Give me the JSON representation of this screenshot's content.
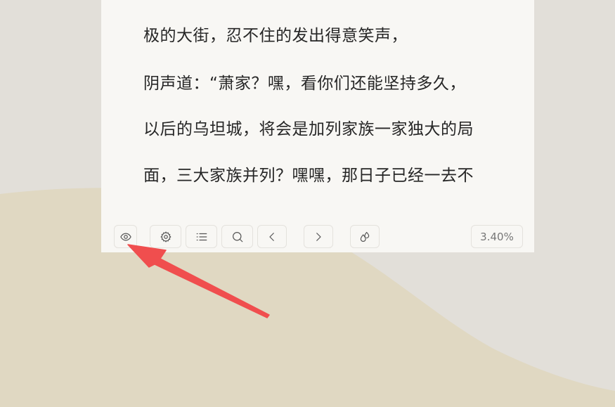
{
  "reader": {
    "lines": [
      "极的大街，忍不住的发出得意笑声，",
      "阴声道：“萧家？嘿，看你们还能坚持多久，",
      "以后的乌坦城，将会是加列家族一家独大的局",
      "面，三大家族并列？嘿嘿，那日子已经一去不"
    ]
  },
  "toolbar": {
    "buttons": [
      {
        "name": "eye-button",
        "icon": "eye-icon"
      },
      {
        "name": "settings-button",
        "icon": "gear-icon"
      },
      {
        "name": "toc-button",
        "icon": "list-icon"
      },
      {
        "name": "search-button",
        "icon": "search-icon"
      },
      {
        "name": "prev-page-button",
        "icon": "chevron-left-icon"
      },
      {
        "name": "next-page-button",
        "icon": "chevron-right-icon"
      },
      {
        "name": "theme-button",
        "icon": "droplets-icon"
      }
    ],
    "progress": "3.40%"
  },
  "colors": {
    "page_background": "#e2dfd9",
    "wave": "#e0d8c2",
    "panel": "#f8f7f4",
    "text": "#262626",
    "arrow": "#f04e4e"
  }
}
